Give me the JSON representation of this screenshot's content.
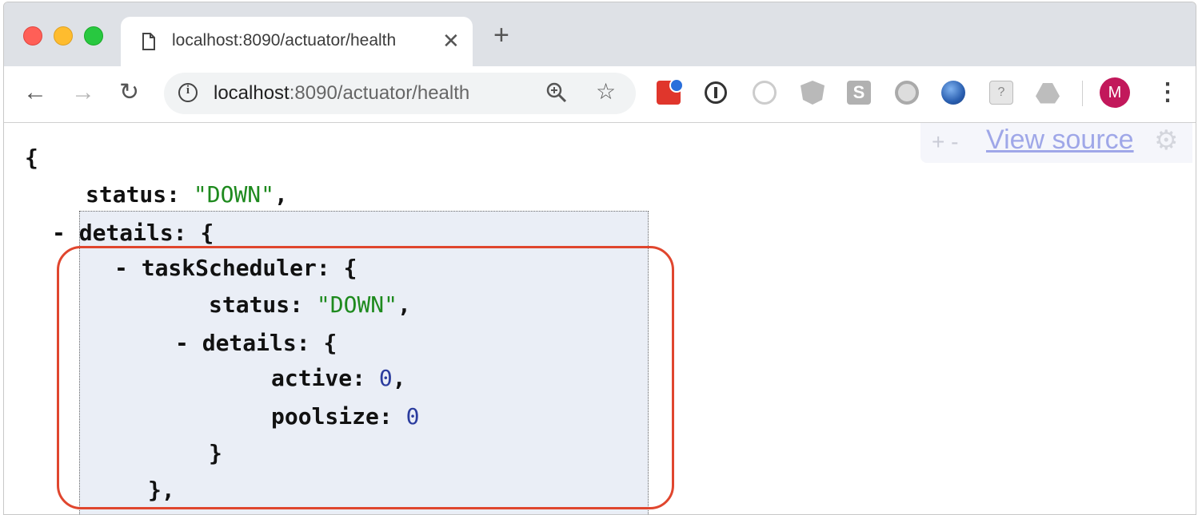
{
  "tab": {
    "title": "localhost:8090/actuator/health",
    "close": "✕",
    "new_tab": "+"
  },
  "toolbar": {
    "back": "←",
    "forward": "→",
    "reload": "↻",
    "url_host": "localhost",
    "url_rest": ":8090/actuator/health",
    "star": "☆",
    "avatar_letter": "M",
    "ext_s_label": "S",
    "ext_help_label": "?",
    "menu": "⋮"
  },
  "viewer": {
    "expand_collapse": "+ -",
    "view_source": "View source",
    "gear": "⚙"
  },
  "json": {
    "open_brace": "{",
    "status_key": "status:",
    "status_value": "\"DOWN\"",
    "comma": ",",
    "collapse": "-",
    "details_key": "details:",
    "brace": "{",
    "task_key": "taskScheduler:",
    "task_status_key": "status:",
    "task_status_value": "\"DOWN\"",
    "task_details_key": "details:",
    "active_key": "active:",
    "active_value": "0",
    "poolsize_key": "poolsize:",
    "poolsize_value": "0",
    "close_brace": "}",
    "close_brace_comma": "},"
  },
  "colors": {
    "callout": "#e0462e",
    "string": "#1e8a1e",
    "number": "#2b3c9e",
    "highlight": "#eaeef6"
  }
}
